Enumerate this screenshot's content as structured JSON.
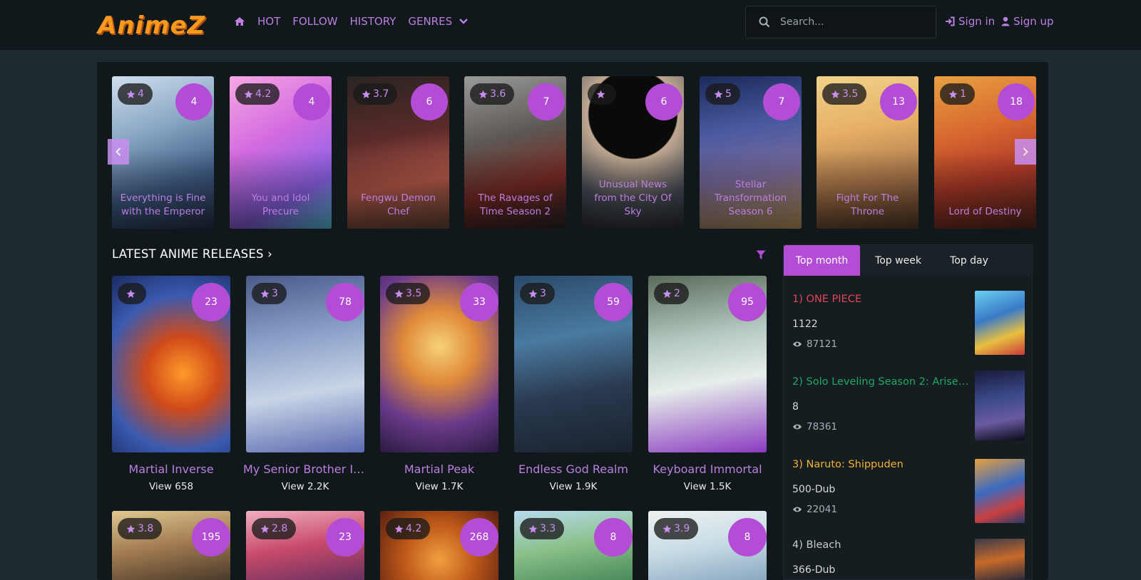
{
  "header": {
    "logo_text": "AnimeZ",
    "nav": [
      {
        "label": "HOT"
      },
      {
        "label": "FOLLOW"
      },
      {
        "label": "HISTORY"
      },
      {
        "label": "GENRES"
      }
    ],
    "search_placeholder": "Search...",
    "sign_in": "Sign in",
    "sign_up": "Sign up"
  },
  "carousel": [
    {
      "rating": "4",
      "episodes": "4",
      "title": "Everything is Fine with the Emperor"
    },
    {
      "rating": "4.2",
      "episodes": "4",
      "title": "You and Idol Precure"
    },
    {
      "rating": "3.7",
      "episodes": "6",
      "title": "Fengwu Demon Chef"
    },
    {
      "rating": "3.6",
      "episodes": "7",
      "title": "The Ravages of Time Season 2"
    },
    {
      "rating": "",
      "episodes": "6",
      "title": "Unusual News from the City Of Sky"
    },
    {
      "rating": "5",
      "episodes": "7",
      "title": "Stellar Transformation Season 6"
    },
    {
      "rating": "3.5",
      "episodes": "13",
      "title": "Fight For The Throne"
    },
    {
      "rating": "1",
      "episodes": "18",
      "title": "Lord of Destiny"
    }
  ],
  "latest": {
    "title": "LATEST ANIME RELEASES",
    "items": [
      {
        "rating": "",
        "episodes": "23",
        "title": "Martial Inverse",
        "views": "View 658"
      },
      {
        "rating": "3",
        "episodes": "78",
        "title": "My Senior Brother Is ...",
        "views": "View 2.2K"
      },
      {
        "rating": "3.5",
        "episodes": "33",
        "title": "Martial Peak",
        "views": "View 1.7K"
      },
      {
        "rating": "3",
        "episodes": "59",
        "title": "Endless God Realm",
        "views": "View 1.9K"
      },
      {
        "rating": "2",
        "episodes": "95",
        "title": "Keyboard Immortal",
        "views": "View 1.5K"
      },
      {
        "rating": "3.8",
        "episodes": "195"
      },
      {
        "rating": "2.8",
        "episodes": "23"
      },
      {
        "rating": "4.2",
        "episodes": "268"
      },
      {
        "rating": "3.3",
        "episodes": "8"
      },
      {
        "rating": "3.9",
        "episodes": "8"
      }
    ]
  },
  "sidebar": {
    "tabs": [
      {
        "label": "Top month"
      },
      {
        "label": "Top week"
      },
      {
        "label": "Top day"
      }
    ],
    "top": [
      {
        "title": "1) ONE PIECE",
        "episode": "1122",
        "views": "87121",
        "color": "#e0455a"
      },
      {
        "title": "2) Solo Leveling Season 2: Arise fro...",
        "episode": "8",
        "views": "78361",
        "color": "#1fa866"
      },
      {
        "title": "3) Naruto: Shippuden",
        "episode": "500-Dub",
        "views": "22041",
        "color": "#f2b233"
      },
      {
        "title": "4) Bleach",
        "episode": "366-Dub",
        "views": "",
        "color": "#c9c9c9"
      }
    ]
  },
  "colors": {
    "accent": "#b44dd6",
    "link": "#bb7fe0",
    "header_bg": "#10181c",
    "panel_bg": "#11181c",
    "page_bg": "#1e2a30",
    "logo": "#f59a1f"
  },
  "icons": {
    "home": "home-icon",
    "chevron": "chevron-down-icon",
    "search": "search-icon",
    "sign_in": "sign-in-icon",
    "sign_up": "user-icon",
    "star": "star-icon",
    "eye": "eye-icon",
    "filter": "filter-icon",
    "prev": "chevron-left-icon",
    "next": "chevron-right-icon"
  }
}
